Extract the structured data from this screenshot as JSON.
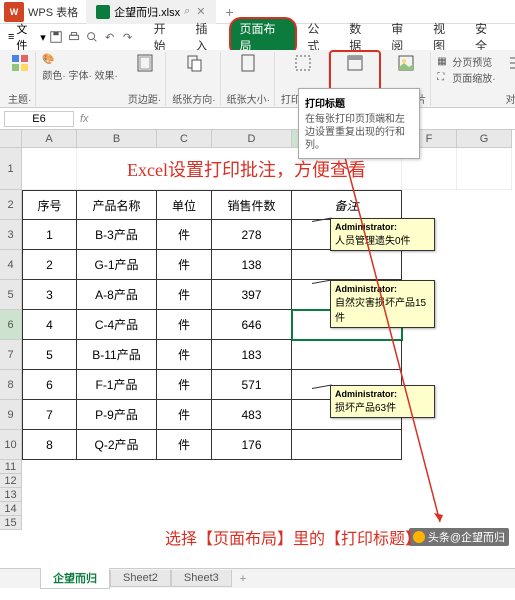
{
  "titlebar": {
    "app": "WPS 表格",
    "filename": "企望而归.xlsx"
  },
  "menubar": {
    "file": "文件",
    "items": [
      "开始",
      "插入",
      "页面布局",
      "公式",
      "数据",
      "审阅",
      "视图",
      "安全"
    ],
    "highlight_index": 2
  },
  "ribbon": {
    "theme": "主题·",
    "font": "颜色·  字体·  效果·",
    "margin": "页边距·",
    "orient": "纸张方向·",
    "size": "纸张大小·",
    "area": "打印区域·",
    "title": "打印标题",
    "bg": "背景图片",
    "right1": "分页预览",
    "right2": "页面缩放·",
    "align": "对齐·"
  },
  "tooltip": {
    "title": "打印标题",
    "body": "在每张打印页顶端和左边设置重复出现的行和列。"
  },
  "namebox": {
    "ref": "E6"
  },
  "columns": [
    "A",
    "B",
    "C",
    "D",
    "E",
    "F",
    "G"
  ],
  "rows": [
    "1",
    "2",
    "3",
    "4",
    "5",
    "6",
    "7",
    "8",
    "9",
    "10",
    "11",
    "12",
    "13",
    "14",
    "15"
  ],
  "title_text": "Excel设置打印批注，方便查看",
  "headers": {
    "a": "序号",
    "b": "产品名称",
    "c": "单位",
    "d": "销售件数",
    "e": "备注"
  },
  "data_rows": [
    {
      "n": "1",
      "name": "B-3产品",
      "unit": "件",
      "qty": "278"
    },
    {
      "n": "2",
      "name": "G-1产品",
      "unit": "件",
      "qty": "138"
    },
    {
      "n": "3",
      "name": "A-8产品",
      "unit": "件",
      "qty": "397"
    },
    {
      "n": "4",
      "name": "C-4产品",
      "unit": "件",
      "qty": "646"
    },
    {
      "n": "5",
      "name": "B-11产品",
      "unit": "件",
      "qty": "183"
    },
    {
      "n": "6",
      "name": "F-1产品",
      "unit": "件",
      "qty": "571"
    },
    {
      "n": "7",
      "name": "P-9产品",
      "unit": "件",
      "qty": "483"
    },
    {
      "n": "8",
      "name": "Q-2产品",
      "unit": "件",
      "qty": "176"
    }
  ],
  "comments": [
    {
      "author": "Administrator:",
      "text": "人员管理遗失0件"
    },
    {
      "author": "Administrator:",
      "text": "自然灾害损坏产品15件"
    },
    {
      "author": "Administrator:",
      "text": "损坏产品63件"
    }
  ],
  "annotation": "选择【页面布局】里的【打印标题】",
  "sheets": {
    "active": "企望而归",
    "others": [
      "Sheet2",
      "Sheet3"
    ]
  },
  "watermark": "头条@企望而归",
  "chart_data": {
    "type": "table",
    "title": "Excel设置打印批注，方便查看",
    "columns": [
      "序号",
      "产品名称",
      "单位",
      "销售件数",
      "备注"
    ],
    "rows": [
      [
        "1",
        "B-3产品",
        "件",
        278,
        "人员管理遗失0件"
      ],
      [
        "2",
        "G-1产品",
        "件",
        138,
        ""
      ],
      [
        "3",
        "A-8产品",
        "件",
        397,
        "自然灾害损坏产品15件"
      ],
      [
        "4",
        "C-4产品",
        "件",
        646,
        ""
      ],
      [
        "5",
        "B-11产品",
        "件",
        183,
        ""
      ],
      [
        "6",
        "F-1产品",
        "件",
        571,
        "损坏产品63件"
      ],
      [
        "7",
        "P-9产品",
        "件",
        483,
        ""
      ],
      [
        "8",
        "Q-2产品",
        "件",
        176,
        ""
      ]
    ]
  }
}
